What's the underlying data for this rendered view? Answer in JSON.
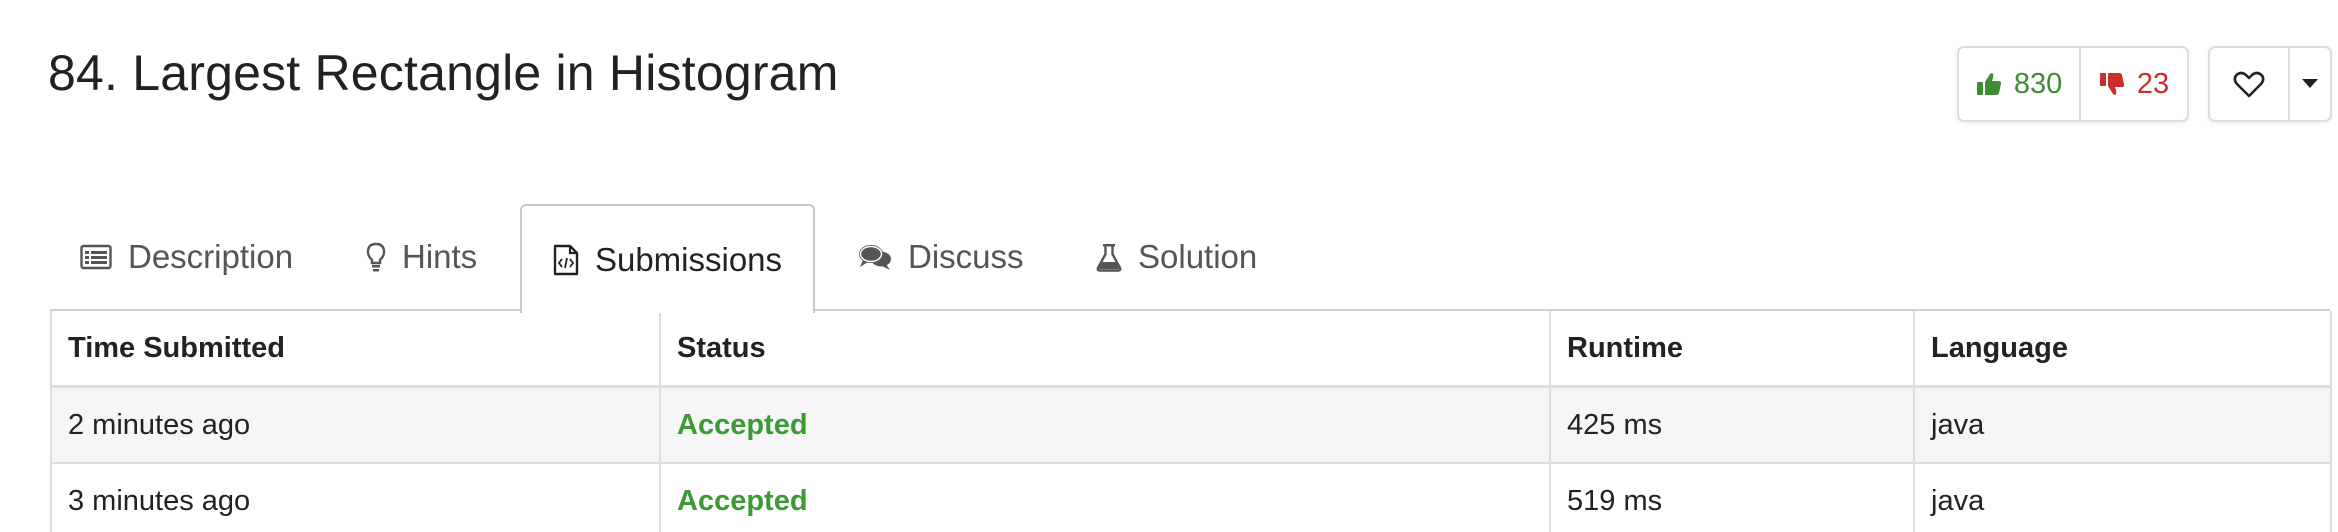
{
  "problem": {
    "title": "84. Largest Rectangle in Histogram"
  },
  "votes": {
    "likes": "830",
    "dislikes": "23",
    "like_icon": "thumbs-up-icon",
    "dislike_icon": "thumbs-down-icon",
    "like_color": "#3f8c35",
    "dislike_color": "#c9302c"
  },
  "favorite": {
    "icon": "heart-outline-icon",
    "dropdown_icon": "caret-down-icon"
  },
  "tabs": [
    {
      "label": "Description",
      "icon": "list-icon",
      "active": false
    },
    {
      "label": "Hints",
      "icon": "lightbulb-icon",
      "active": false
    },
    {
      "label": "Submissions",
      "icon": "code-file-icon",
      "active": true
    },
    {
      "label": "Discuss",
      "icon": "comments-icon",
      "active": false
    },
    {
      "label": "Solution",
      "icon": "flask-icon",
      "active": false
    }
  ],
  "submissions": {
    "columns": [
      "Time Submitted",
      "Status",
      "Runtime",
      "Language"
    ],
    "rows": [
      {
        "time": "2 minutes ago",
        "status": "Accepted",
        "runtime": "425 ms",
        "language": "java"
      },
      {
        "time": "3 minutes ago",
        "status": "Accepted",
        "runtime": "519 ms",
        "language": "java"
      }
    ],
    "accepted_color": "#3c9a35"
  }
}
